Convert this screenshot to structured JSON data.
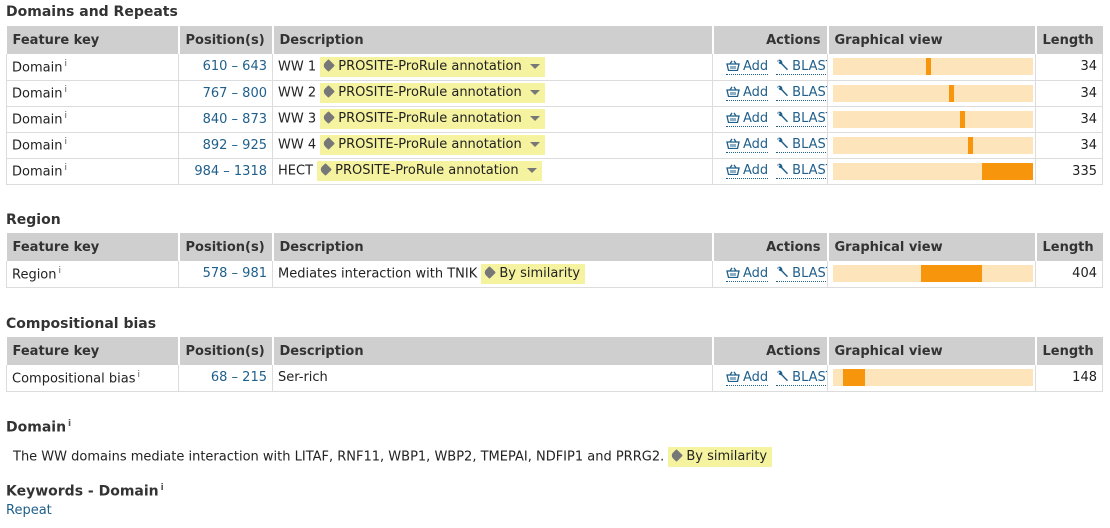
{
  "headers": {
    "feature_key": "Feature key",
    "positions": "Position(s)",
    "description": "Description",
    "actions": "Actions",
    "graphical_view": "Graphical view",
    "length": "Length"
  },
  "actions": {
    "add": "Add",
    "blast": "BLAST"
  },
  "info_marker": "i",
  "colors": {
    "bar_track": "#fde4ba",
    "bar_fill": "#f7960d",
    "evidence_bg": "#f6f3a0",
    "link": "#1f5f8b",
    "header_bg": "#cfcfcf"
  },
  "domains_section": {
    "title": "Domains and Repeats",
    "rows": [
      {
        "key": "Domain",
        "position": "610 – 643",
        "desc": "WW 1",
        "evidence": "PROSITE-ProRule annotation",
        "length": "34",
        "bar_start_frac": 0.465,
        "bar_width_frac": 0.025
      },
      {
        "key": "Domain",
        "position": "767 – 800",
        "desc": "WW 2",
        "evidence": "PROSITE-ProRule annotation",
        "length": "34",
        "bar_start_frac": 0.58,
        "bar_width_frac": 0.025
      },
      {
        "key": "Domain",
        "position": "840 – 873",
        "desc": "WW 3",
        "evidence": "PROSITE-ProRule annotation",
        "length": "34",
        "bar_start_frac": 0.635,
        "bar_width_frac": 0.025
      },
      {
        "key": "Domain",
        "position": "892 – 925",
        "desc": "WW 4",
        "evidence": "PROSITE-ProRule annotation",
        "length": "34",
        "bar_start_frac": 0.673,
        "bar_width_frac": 0.025
      },
      {
        "key": "Domain",
        "position": "984 – 1318",
        "desc": "HECT",
        "evidence": "PROSITE-ProRule annotation",
        "length": "335",
        "bar_start_frac": 0.745,
        "bar_width_frac": 0.255
      }
    ]
  },
  "region_section": {
    "title": "Region",
    "rows": [
      {
        "key": "Region",
        "position": "578 – 981",
        "desc": "Mediates interaction with TNIK",
        "evidence": "By similarity",
        "length": "404",
        "bar_start_frac": 0.44,
        "bar_width_frac": 0.305
      }
    ]
  },
  "bias_section": {
    "title": "Compositional bias",
    "rows": [
      {
        "key": "Compositional bias",
        "position": "68 – 215",
        "desc": "Ser-rich",
        "length": "148",
        "bar_start_frac": 0.05,
        "bar_width_frac": 0.11
      }
    ]
  },
  "domain_comment": {
    "title": "Domain",
    "text": "The WW domains mediate interaction with LITAF, RNF11, WBP1, WBP2, TMEPAI, NDFIP1 and PRRG2.",
    "evidence": "By similarity"
  },
  "keywords": {
    "title": "Keywords - Domain",
    "items": [
      "Repeat"
    ]
  }
}
